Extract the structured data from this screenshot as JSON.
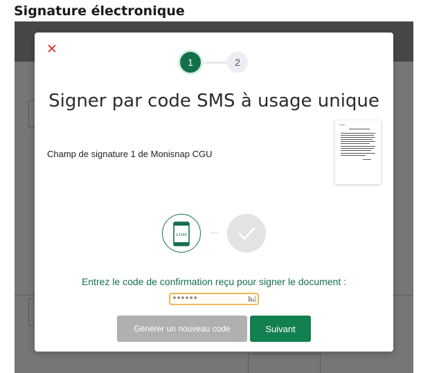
{
  "page": {
    "title": "Signature électronique"
  },
  "modal": {
    "close_icon": "close-icon",
    "steps": [
      {
        "label": "1",
        "state": "active"
      },
      {
        "label": "2",
        "state": "inactive"
      }
    ],
    "title": "Signer par code SMS à usage unique",
    "field_label": "Champ de signature 1 de Monisnap CGU",
    "phone_code_text": "12345",
    "instruction": "Entrez le code de confirmation reçu pour signer le document :",
    "code_input": {
      "value": "******",
      "placeholder": ""
    },
    "buttons": {
      "generate_label": "Générer un nouveau code",
      "next_label": "Suivant"
    }
  },
  "colors": {
    "accent": "#13704a",
    "close": "#d9342b",
    "input_border": "#f0b657",
    "disabled_button": "#b0b0b0",
    "primary_button": "#13804f"
  }
}
